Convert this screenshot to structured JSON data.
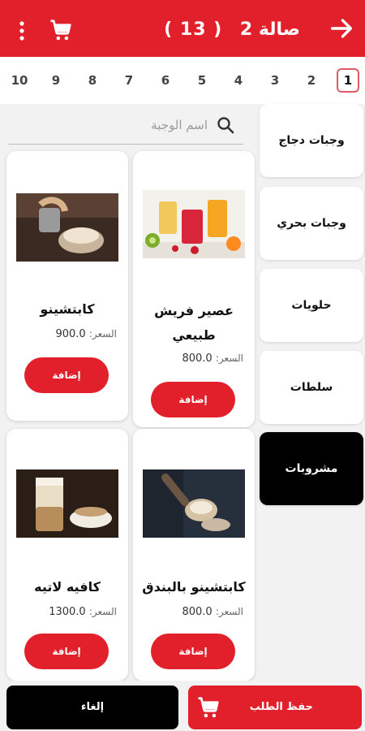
{
  "header": {
    "title": "صالة 2",
    "count": "( 13 )"
  },
  "pages": [
    "1",
    "2",
    "3",
    "4",
    "5",
    "6",
    "7",
    "8",
    "9",
    "10"
  ],
  "active_page": "1",
  "search": {
    "placeholder": "اسم الوجبة"
  },
  "categories": [
    {
      "label": "وجبات دجاج"
    },
    {
      "label": "وجبات بحري"
    },
    {
      "label": "حلويات"
    },
    {
      "label": "سلطات"
    },
    {
      "label": "مشروبات"
    }
  ],
  "active_category": "مشروبات",
  "products": [
    {
      "name": "عصير فريش طبيعي",
      "price_label": "السعر:",
      "price": "800.0",
      "add_label": "إضافة"
    },
    {
      "name": "كابتشينو",
      "price_label": "السعر:",
      "price": "900.0",
      "add_label": "إضافة"
    },
    {
      "name": "كابتشينو بالبندق",
      "price_label": "السعر:",
      "price": "800.0",
      "add_label": "إضافة"
    },
    {
      "name": "كافيه لاتيه",
      "price_label": "السعر:",
      "price": "1300.0",
      "add_label": "إضافة"
    }
  ],
  "bottom": {
    "save_label": "حفظ الطلب",
    "cancel_label": "إلغاء"
  },
  "colors": {
    "primary": "#e2202c",
    "active_category": "#000000",
    "background": "#f2f2f2"
  }
}
